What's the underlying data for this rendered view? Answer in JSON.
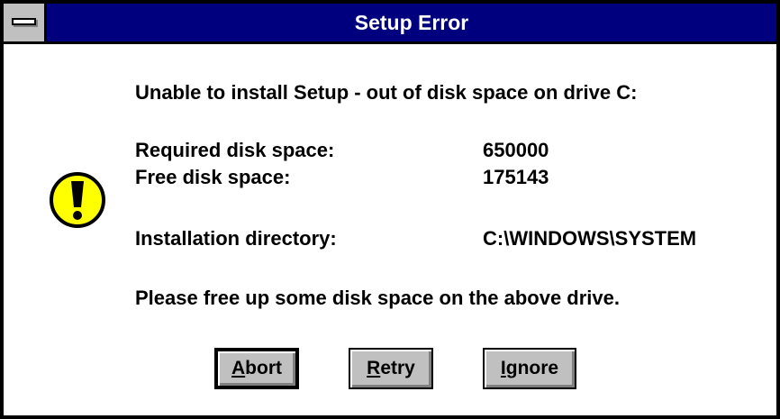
{
  "window": {
    "title": "Setup Error"
  },
  "message": {
    "headline": "Unable to install Setup - out of disk space on drive C:",
    "required_label": "Required disk space:",
    "required_value": "650000",
    "free_label": "Free disk space:",
    "free_value": "175143",
    "dir_label": "Installation directory:",
    "dir_value": "C:\\WINDOWS\\SYSTEM",
    "instruction": "Please free up some disk space on the above drive."
  },
  "icons": {
    "system_menu": "system-menu-icon",
    "alert": "exclamation-icon"
  },
  "buttons": {
    "abort": {
      "mnemonic": "A",
      "rest": "bort"
    },
    "retry": {
      "mnemonic": "R",
      "rest": "etry"
    },
    "ignore": {
      "mnemonic": "I",
      "rest": "gnore"
    }
  },
  "colors": {
    "titlebar": "#00007f",
    "button_face": "#c0c0c0",
    "alert_icon": "#ffff00"
  }
}
